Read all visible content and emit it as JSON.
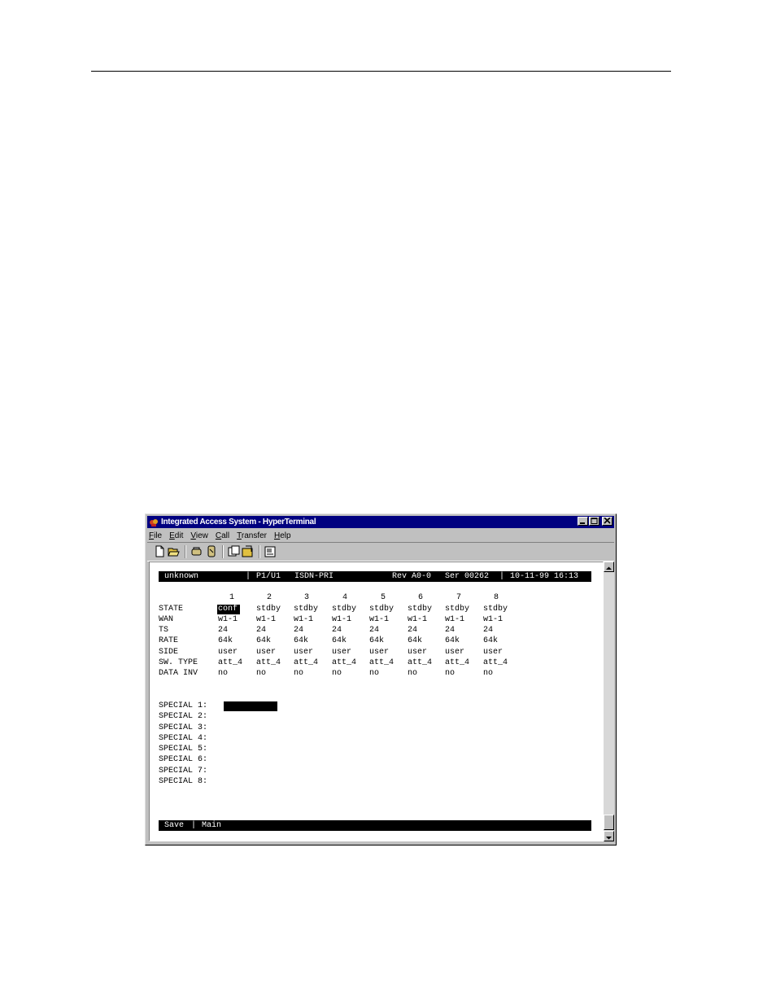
{
  "window": {
    "title": "Integrated Access System - HyperTerminal",
    "controls": [
      "minimize",
      "maximize",
      "close"
    ]
  },
  "menu": [
    {
      "label": "File",
      "key": "F"
    },
    {
      "label": "Edit",
      "key": "E"
    },
    {
      "label": "View",
      "key": "V"
    },
    {
      "label": "Call",
      "key": "C"
    },
    {
      "label": "Transfer",
      "key": "T"
    },
    {
      "label": "Help",
      "key": "H"
    }
  ],
  "toolbar": {
    "icons": [
      "new-icon",
      "open-icon",
      "connect-icon",
      "disconnect-icon",
      "send-icon",
      "receive-icon",
      "properties-icon"
    ]
  },
  "terminal": {
    "header": {
      "node": "unknown",
      "sep1": "|",
      "slot": "P1/U1",
      "card": "ISDN-PRI",
      "rev": "Rev A0-0",
      "ser": "Ser 00262",
      "sep2": "|",
      "datetime": "10-11-99 16:13"
    },
    "columns": [
      "1",
      "2",
      "3",
      "4",
      "5",
      "6",
      "7",
      "8"
    ],
    "rows": [
      {
        "label": "STATE",
        "values": [
          "conf",
          "stdby",
          "stdby",
          "stdby",
          "stdby",
          "stdby",
          "stdby",
          "stdby"
        ]
      },
      {
        "label": "WAN",
        "values": [
          "w1-1",
          "w1-1",
          "w1-1",
          "w1-1",
          "w1-1",
          "w1-1",
          "w1-1",
          "w1-1"
        ]
      },
      {
        "label": "TS",
        "values": [
          "24",
          "24",
          "24",
          "24",
          "24",
          "24",
          "24",
          "24"
        ]
      },
      {
        "label": "RATE",
        "values": [
          "64k",
          "64k",
          "64k",
          "64k",
          "64k",
          "64k",
          "64k",
          "64k"
        ]
      },
      {
        "label": "SIDE",
        "values": [
          "user",
          "user",
          "user",
          "user",
          "user",
          "user",
          "user",
          "user"
        ]
      },
      {
        "label": "SW. TYPE",
        "values": [
          "att_4",
          "att_4",
          "att_4",
          "att_4",
          "att_4",
          "att_4",
          "att_4",
          "att_4"
        ]
      },
      {
        "label": "DATA INV",
        "values": [
          "no",
          "no",
          "no",
          "no",
          "no",
          "no",
          "no",
          "no"
        ]
      }
    ],
    "specials": [
      "SPECIAL 1:",
      "SPECIAL 2:",
      "SPECIAL 3:",
      "SPECIAL 4:",
      "SPECIAL 5:",
      "SPECIAL 6:",
      "SPECIAL 7:",
      "SPECIAL 8:"
    ],
    "footer": {
      "save": "Save",
      "sep": "|",
      "main": "Main"
    }
  }
}
